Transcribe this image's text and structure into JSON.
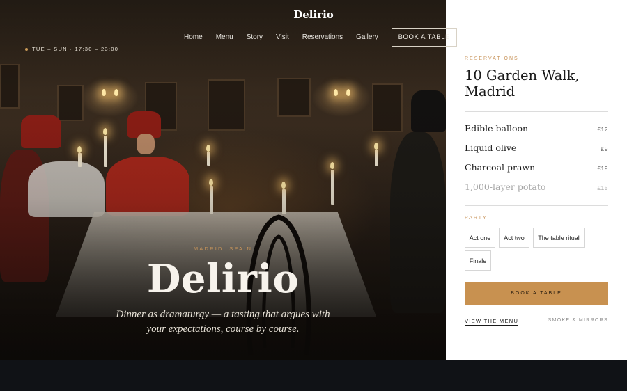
{
  "brand": {
    "logo": "Delirio"
  },
  "nav": {
    "items": [
      "Home",
      "Menu",
      "Story",
      "Visit",
      "Reservations",
      "Gallery"
    ],
    "cta": "BOOK A TABLE"
  },
  "hours": "TUE – SUN · 17:30 – 23:00",
  "hero": {
    "eyebrow": "MADRID, SPAIN",
    "title": "Delirio",
    "subtitle": "Dinner as dramaturgy — a tasting that argues with your expectations, course by course."
  },
  "panel": {
    "section_label": "RESERVATIONS",
    "address": "10 Garden Walk, Madrid",
    "menu": [
      {
        "name": "Edible balloon",
        "price": "£12"
      },
      {
        "name": "Liquid olive",
        "price": "£9"
      },
      {
        "name": "Charcoal prawn",
        "price": "£19"
      },
      {
        "name": "1,000-layer potato",
        "price": "£15"
      }
    ],
    "party_label": "PARTY",
    "party_options": [
      "Act one",
      "Act two",
      "The table ritual",
      "Finale"
    ],
    "cta": "BOOK A TABLE",
    "menu_link": "VIEW THE MENU",
    "tagline": "SMOKE & MIRRORS"
  },
  "colors": {
    "accent": "#c89150",
    "panel_bg": "#ffffff",
    "footer_bg": "#101216"
  }
}
